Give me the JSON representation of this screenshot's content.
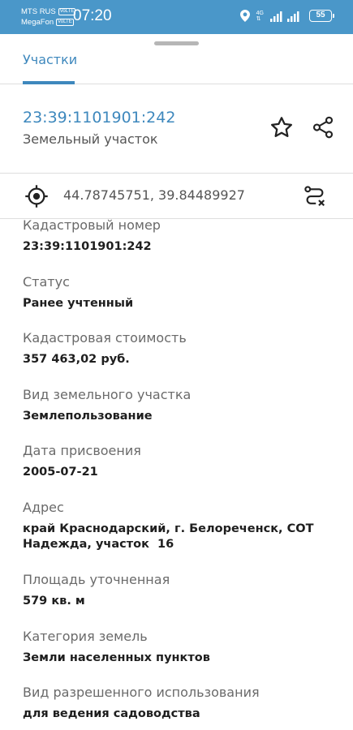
{
  "status_bar": {
    "carrier1": "MTS RUS",
    "carrier2": "MegaFon",
    "volte": "VoLTE",
    "time": "07:20",
    "network": "4G",
    "battery": "55",
    "icons": [
      "location-icon",
      "signal-icon",
      "battery-icon"
    ]
  },
  "tabs": [
    {
      "label": "Участки",
      "active": true
    }
  ],
  "parcel": {
    "number": "23:39:1101901:242",
    "type": "Земельный участок"
  },
  "coords": {
    "text": "44.78745751, 39.84489927"
  },
  "fields": [
    {
      "label": "Кадастровый номер",
      "value": "23:39:1101901:242"
    },
    {
      "label": "Статус",
      "value": "Ранее учтенный"
    },
    {
      "label": "Кадастровая стоимость",
      "value": "357 463,02 руб."
    },
    {
      "label": "Вид земельного участка",
      "value": "Землепользование"
    },
    {
      "label": "Дата присвоения",
      "value": "2005-07-21"
    },
    {
      "label": "Адрес",
      "value": "край Краснодарский, г. Белореченск, СОТ Надежда, участок  16"
    },
    {
      "label": "Площадь уточненная",
      "value": "579 кв. м"
    },
    {
      "label": "Категория земель",
      "value": "Земли населенных пунктов"
    },
    {
      "label": "Вид разрешенного использования",
      "value": "для ведения садоводства"
    }
  ],
  "colors": {
    "accent": "#3e88bd",
    "status_bar": "#4a97c9"
  }
}
